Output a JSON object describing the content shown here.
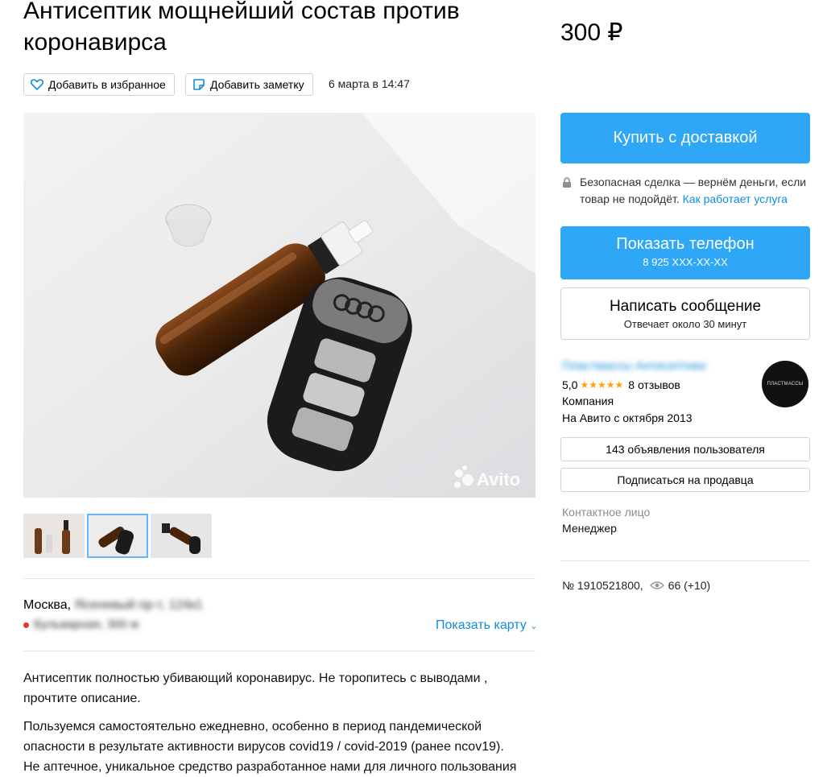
{
  "listing": {
    "title": "Антисептик мощнейший состав против коронавирса",
    "price": "300 ₽",
    "date": "6 марта в 14:47",
    "favorite_label": "Добавить в избранное",
    "note_label": "Добавить заметку",
    "watermark": "Avito"
  },
  "actions": {
    "buy_label": "Купить с доставкой",
    "safe_deal_text": "Безопасная сделка — вернём деньги, если товар не подойдёт.",
    "safe_deal_link": "Как работает услуга",
    "phone_label": "Показать телефон",
    "phone_number": "8 925 XXX-XX-XX",
    "message_label": "Написать сообщение",
    "message_sub": "Отвечает около 30 минут"
  },
  "seller": {
    "name": "Пластмассы Антисептики",
    "rating": "5,0",
    "stars": "★★★★★",
    "reviews": "8 отзывов",
    "type": "Компания",
    "since": "На Авито с октября 2013",
    "avatar_text": "ПЛАСТМАССЫ",
    "ads_button": "143 объявления пользователя",
    "subscribe_button": "Подписаться на продавца",
    "contact_label": "Контактное лицо",
    "contact_name": "Менеджер"
  },
  "meta": {
    "id_text": "№ 1910521800,",
    "views": "66 (+10)"
  },
  "location": {
    "city": "Москва,",
    "address": "Ясеневый пр-т, 124к1",
    "metro": "Бульварная, 300 м",
    "show_map": "Показать карту",
    "metro_color": "#e5353a"
  },
  "description": {
    "p1": "Антисептик полностью убивающий коронавирус. Не торопитесь с выводами , прочтите описание.",
    "p2": "Пользуемся самостоятельно ежедневно, особенно в период пандемической опасности в результате активности вирусов covid19 / covid-2019 (ранее ncov19). Не аптечное, уникальное средство разработанное нами для личного пользования"
  },
  "colors": {
    "accent": "#2ea7f7",
    "link": "#0f8ddb",
    "star": "#ffa400"
  }
}
